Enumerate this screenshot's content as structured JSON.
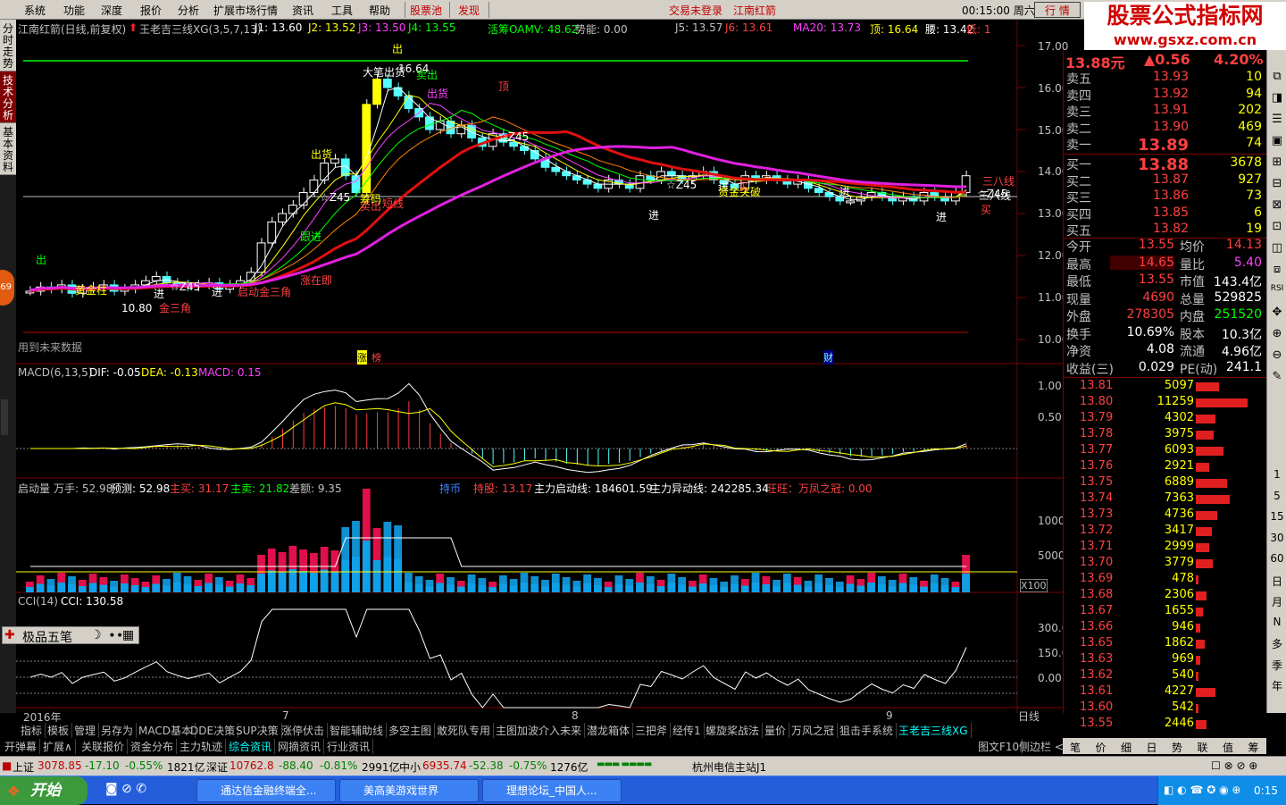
{
  "menu": [
    "系统",
    "功能",
    "深度",
    "报价",
    "分析",
    "扩展市场行情",
    "资讯",
    "工具",
    "帮助"
  ],
  "menu_red": [
    "股票池",
    "发现"
  ],
  "login_text": "交易未登录",
  "header_stock": "江南红箭",
  "clock": "00:15:00 周六",
  "quote_btn": "行 情",
  "ad_title": "股票公式指标网",
  "ad_url": "www.gsxz.com.cn",
  "left_tabs": [
    "分时走势",
    "技术分析",
    "基本资料"
  ],
  "bubble": "69",
  "main_hdr": {
    "title": "江南红箭(日线,前复权)",
    "formula": "王老吉三线XG(3,5,7,13)",
    "j1": "J1: 13.60",
    "j2": "J2: 13.52",
    "j3": "J3: 13.50",
    "j4": "J4: 13.55",
    "oamv": "活筹OAMV: 48.62",
    "shi": "势能: 0.00",
    "j5": "J5: 13.57",
    "j6": "J6: 13.61",
    "ma20": "MA20: 13.73",
    "ding": "顶: 16.64",
    "yao": "腰: 13.42",
    "di": "低: 1"
  },
  "price_axis": [
    "17.00",
    "16.00",
    "15.00",
    "14.00",
    "13.00",
    "12.00",
    "11.00",
    "10.00"
  ],
  "future_note": "用到未来数据",
  "event_marks": [
    "涨",
    "榜",
    "财"
  ],
  "annotations": [
    "出",
    "大笔出货",
    "16.64",
    "卖出",
    "出货",
    "顶",
    "出货",
    "卖出",
    "跟进",
    "涨在即",
    "启动金三角",
    "10.80",
    "金三角",
    "进",
    "进",
    "进",
    "资金突破",
    "买",
    "进",
    "进",
    "进",
    "三八线",
    "三八线",
    "买",
    "出",
    "☆Z45",
    "☆Z45",
    "☆Z45",
    "☆Z45",
    "☆Z45",
    "筹码",
    "黄金柱",
    "短线"
  ],
  "macd_hdr": {
    "name": "MACD(6,13,5)",
    "dif": "DIF: -0.05",
    "dea": "DEA: -0.13",
    "macd": "MACD: 0.15"
  },
  "macd_axis": [
    "1.00",
    "0.50"
  ],
  "vol_hdr": {
    "name": "启动量",
    "wan": "万手: 52.98",
    "yc": "预测: 52.98",
    "zm": "主买: 31.17",
    "zs": "主卖: 21.82",
    "ce": "差额: 9.35",
    "cb": "持币",
    "cg": "持股: 13.17",
    "qd": "主力启动线: 184601.59",
    "yd": "主力异动线: 242285.34",
    "ww": "旺旺：万凤之冠: 0.00"
  },
  "vol_axis": [
    "10000",
    "5000"
  ],
  "vol_unit": "X100",
  "cci_hdr": {
    "name": "CCI(14)",
    "cci": "CCI: 130.58"
  },
  "cci_axis": [
    "300.0",
    "150.0",
    "0.00"
  ],
  "x_axis": [
    "2016年",
    "7",
    "8",
    "9"
  ],
  "period": "日线",
  "float_bar": "极品五笔",
  "quote": {
    "price": "13.88元",
    "change": "▲0.56",
    "pct": "4.20%",
    "asks": [
      [
        "卖五",
        "13.93",
        "10"
      ],
      [
        "卖四",
        "13.92",
        "94"
      ],
      [
        "卖三",
        "13.91",
        "202"
      ],
      [
        "卖二",
        "13.90",
        "469"
      ],
      [
        "卖一",
        "13.89",
        "74"
      ]
    ],
    "bids": [
      [
        "买一",
        "13.88",
        "3678"
      ],
      [
        "买二",
        "13.87",
        "927"
      ],
      [
        "买三",
        "13.86",
        "73"
      ],
      [
        "买四",
        "13.85",
        "6"
      ],
      [
        "买五",
        "13.82",
        "19"
      ]
    ],
    "stats": [
      [
        "今开",
        "13.55",
        "均价",
        "14.13"
      ],
      [
        "最高",
        "14.65",
        "量比",
        "5.40"
      ],
      [
        "最低",
        "13.55",
        "市值",
        "143.4亿"
      ],
      [
        "现量",
        "4690",
        "总量",
        "529825"
      ],
      [
        "外盘",
        "278305",
        "内盘",
        "251520"
      ],
      [
        "换手",
        "10.69%",
        "股本",
        "10.3亿"
      ],
      [
        "净资",
        "4.08",
        "流通",
        "4.96亿"
      ],
      [
        "收益(三)",
        "0.029",
        "PE(动)",
        "241.1"
      ]
    ]
  },
  "ticks": [
    [
      "13.81",
      "5097",
      26
    ],
    [
      "13.80",
      "11259",
      58
    ],
    [
      "13.79",
      "4302",
      22
    ],
    [
      "13.78",
      "3975",
      20
    ],
    [
      "13.77",
      "6093",
      31
    ],
    [
      "13.76",
      "2921",
      15
    ],
    [
      "13.75",
      "6889",
      35
    ],
    [
      "13.74",
      "7363",
      38
    ],
    [
      "13.73",
      "4736",
      24
    ],
    [
      "13.72",
      "3417",
      18
    ],
    [
      "13.71",
      "2999",
      15
    ],
    [
      "13.70",
      "3779",
      19
    ],
    [
      "13.69",
      "478",
      3
    ],
    [
      "13.68",
      "2306",
      12
    ],
    [
      "13.67",
      "1655",
      8
    ],
    [
      "13.66",
      "946",
      5
    ],
    [
      "13.65",
      "1862",
      10
    ],
    [
      "13.63",
      "969",
      5
    ],
    [
      "13.62",
      "540",
      3
    ],
    [
      "13.61",
      "4227",
      22
    ],
    [
      "13.60",
      "542",
      3
    ],
    [
      "13.55",
      "2446",
      12
    ]
  ],
  "right_tools": [
    "1",
    "5",
    "15",
    "30",
    "60",
    "日",
    "月",
    "N",
    "多",
    "季",
    "年"
  ],
  "tabs1": [
    "指标",
    "模板",
    "管理",
    "另存为",
    "MACD基本",
    "DDE决策",
    "SUP决策",
    "涨停伏击",
    "智能辅助线",
    "多空主图",
    "敢死队专用",
    "主图加波介入未来",
    "潜龙箱体",
    "三把斧",
    "经传1",
    "螺旋桨战法",
    "量价",
    "万风之冠",
    "狙击手系统",
    "王老吉三线XG"
  ],
  "tabs2": [
    "开弹幕",
    "扩展∧",
    "关联报价",
    "资金分布",
    "主力轨迹",
    "综合资讯",
    "网摘资讯",
    "行业资讯"
  ],
  "tabs2_right": [
    "图文F10",
    "侧边栏 <"
  ],
  "rtabs": [
    "笔",
    "价",
    "细",
    "日",
    "势",
    "联",
    "值",
    "筹"
  ],
  "status": {
    "sh": "上证",
    "sh_v": "3078.85",
    "sh_c": "-17.10",
    "sh_p": "-0.55%",
    "sh_a": "1821亿",
    "sz": "深证",
    "sz_v": "10762.8",
    "sz_c": "-88.40",
    "sz_p": "-0.81%",
    "sz_a": "2991亿",
    "zx": "中小",
    "zx_v": "6935.74",
    "zx_c": "-52.38",
    "zx_p": "-0.75%",
    "zx_a": "1276亿",
    "server": "杭州电信主站J1"
  },
  "taskbar": {
    "start": "开始",
    "tasks": [
      "通达信金融终端全...",
      "美高美游戏世界",
      "理想论坛_中国人..."
    ],
    "time": "0:15"
  }
}
